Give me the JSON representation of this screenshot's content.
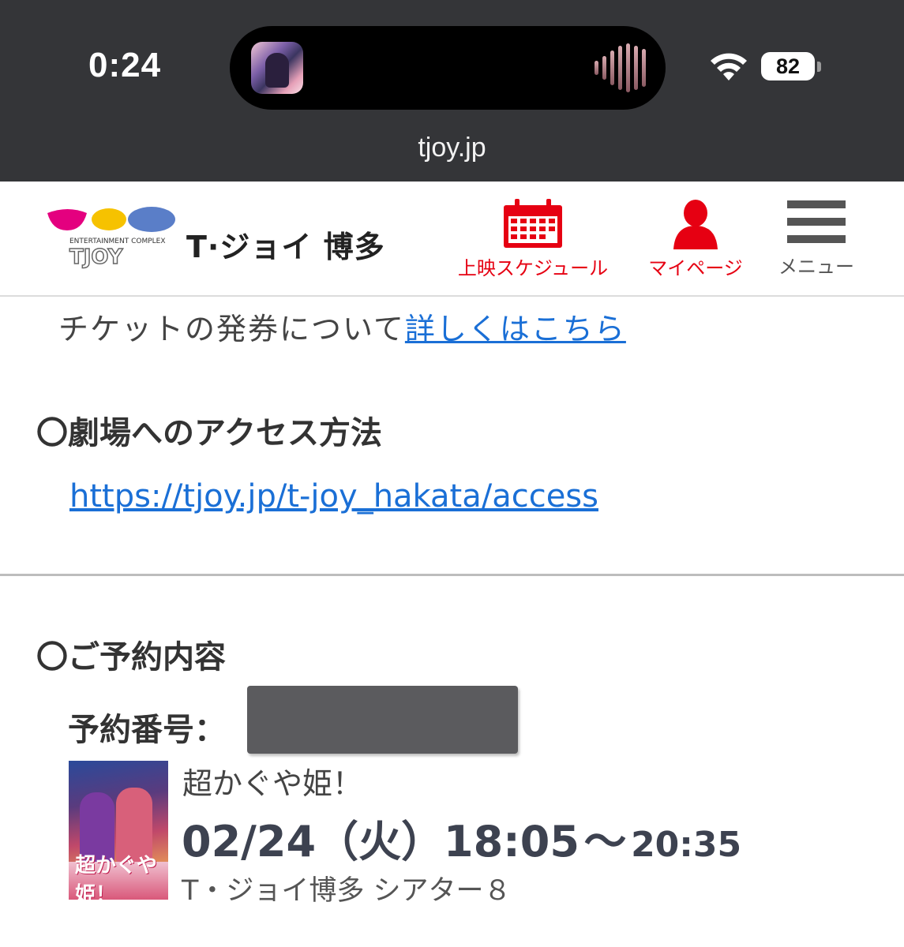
{
  "status_bar": {
    "time": "0:24",
    "battery": "82",
    "url": "tjoy.jp"
  },
  "header": {
    "logo_text": "ENTERTAINMENT COMPLEX T-JOY",
    "theater_name": "T·ジョイ 博多",
    "nav": {
      "schedule_label": "上映スケジュール",
      "mypage_label": "マイページ",
      "menu_label": "メニュー"
    },
    "colors": {
      "accent": "#e60012",
      "link": "#1a6fd6"
    }
  },
  "ticket_note": {
    "text": "チケットの発券について",
    "link_label": "詳しくはこちら"
  },
  "access": {
    "heading": "〇劇場へのアクセス方法",
    "url": "https://tjoy.jp/t-joy_hakata/access"
  },
  "reservation": {
    "heading": "〇ご予約内容",
    "number_label": "予約番号：",
    "movie_title": "超かぐや姫！",
    "date": "02/24（火）",
    "start_time": "18:05",
    "separator": "〜",
    "end_time": "20:35",
    "venue": "T・ジョイ博多 シアター８"
  }
}
